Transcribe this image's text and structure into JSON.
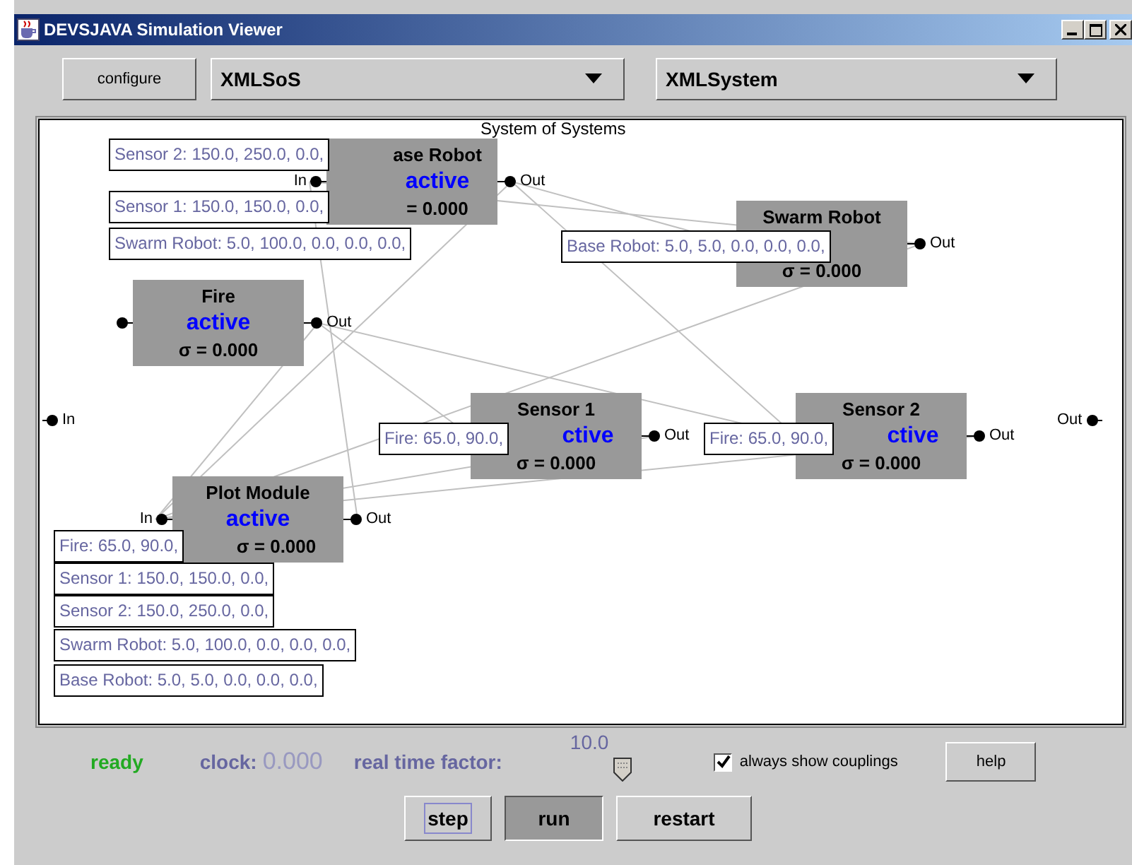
{
  "window": {
    "title": "DEVSJAVA Simulation Viewer"
  },
  "toolbar": {
    "configure_button": "configure",
    "dropdowns": [
      {
        "value": "XMLSoS"
      },
      {
        "value": "XMLSystem"
      }
    ]
  },
  "canvas": {
    "title": "System of Systems",
    "in_label": "In",
    "out_label": "Out",
    "nodes": [
      {
        "title": "ase Robot",
        "status": "active",
        "sigma": "= 0.000",
        "in_port": true,
        "in_label": "In",
        "out_label": "Out"
      },
      {
        "title": "Swarm Robot",
        "sigma": "σ = 0.000",
        "in_port": false,
        "out_label": "Out"
      },
      {
        "title": "Fire",
        "status": "active",
        "sigma": "σ = 0.000",
        "in_port": true,
        "out_label": "Out"
      },
      {
        "title": "Sensor 1",
        "status": "ctive",
        "sigma": "σ = 0.000",
        "in_port": false,
        "out_label": "Out"
      },
      {
        "title": "Sensor 2",
        "status": "ctive",
        "sigma": "σ = 0.000",
        "in_port": false,
        "out_label": "Out"
      },
      {
        "title": "Plot Module",
        "status": "active",
        "sigma": "σ = 0.000",
        "in_port": true,
        "in_label": "In",
        "out_label": "Out"
      }
    ],
    "tooltips": [
      {
        "text": "Sensor 2: 150.0, 250.0, 0.0,"
      },
      {
        "text": "Sensor 1: 150.0, 150.0, 0.0,"
      },
      {
        "text": "Swarm Robot: 5.0, 100.0, 0.0, 0.0, 0.0,"
      },
      {
        "text": "Base Robot: 5.0, 5.0, 0.0, 0.0, 0.0,"
      },
      {
        "text": "Fire: 65.0, 90.0,"
      },
      {
        "text": "Fire: 65.0, 90.0,"
      },
      {
        "text": "Fire: 65.0, 90.0,"
      },
      {
        "text": "Sensor 1: 150.0, 150.0, 0.0,"
      },
      {
        "text": "Sensor 2: 150.0, 250.0, 0.0,"
      },
      {
        "text": "Swarm Robot: 5.0, 100.0, 0.0, 0.0, 0.0,"
      },
      {
        "text": "Base Robot: 5.0, 5.0, 0.0, 0.0, 0.0,"
      }
    ]
  },
  "status": {
    "state": "ready",
    "clock_label": "clock:",
    "clock_value": "0.000",
    "factor_label": "real time factor:",
    "factor_value": "10.0",
    "level": 0.7,
    "couplings_checkbox": {
      "label": "always show couplings",
      "checked": true
    },
    "help_button": "help"
  },
  "buttons": [
    {
      "label": "step",
      "focused": true,
      "pressed": false
    },
    {
      "label": "run",
      "focused": false,
      "pressed": true
    },
    {
      "label": "restart",
      "focused": false,
      "pressed": false
    }
  ]
}
